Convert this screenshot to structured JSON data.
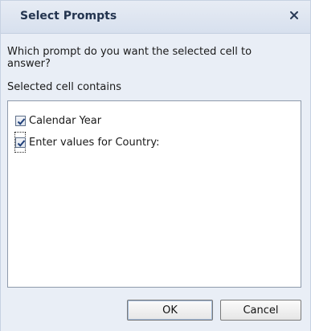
{
  "dialog": {
    "title": "Select Prompts",
    "close_icon": "close-icon",
    "question": "Which prompt do you want the selected cell to answer?",
    "selected_label": "Selected cell contains",
    "items": [
      {
        "label": "Calendar Year",
        "checked": true
      },
      {
        "label": "Enter values for Country:",
        "checked": true
      }
    ],
    "buttons": {
      "ok": "OK",
      "cancel": "Cancel"
    }
  }
}
